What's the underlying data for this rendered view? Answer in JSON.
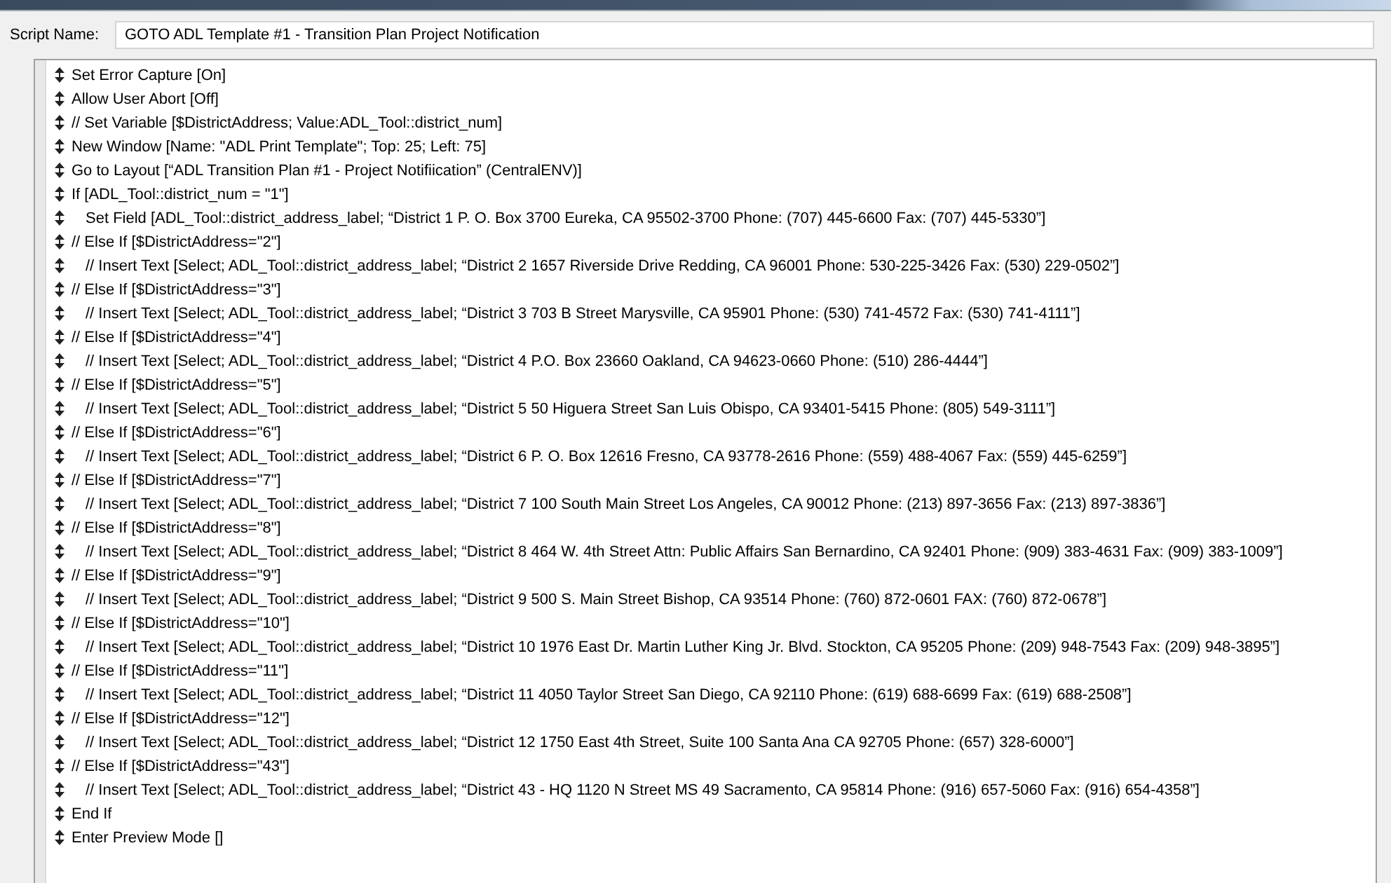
{
  "script_name": {
    "label": "Script Name:",
    "value": "GOTO ADL Template #1 - Transition Plan Project Notification"
  },
  "steps": [
    {
      "text": "Set Error Capture [On]"
    },
    {
      "text": "Allow User Abort [Off]"
    },
    {
      "text": "// Set Variable [$DistrictAddress; Value:ADL_Tool::district_num]"
    },
    {
      "text": "New Window [Name: \"ADL Print Template\"; Top: 25; Left: 75]"
    },
    {
      "text": "Go to Layout [“ADL Transition Plan #1 - Project Notifiication” (CentralENV)]"
    },
    {
      "text": "If [ADL_Tool::district_num = \"1\"]",
      "children": [
        {
          "text": "Set Field [ADL_Tool::district_address_label; “District 1 P. O. Box 3700 Eureka, CA 95502-3700 Phone: (707) 445-6600 Fax: (707) 445-5330”]"
        }
      ]
    },
    {
      "text": "// Else If [$DistrictAddress=\"2\"]",
      "children": [
        {
          "text": "// Insert Text [Select; ADL_Tool::district_address_label; “District 2 1657 Riverside Drive Redding, CA 96001 Phone: 530-225-3426 Fax: (530) 229-0502”]"
        }
      ]
    },
    {
      "text": "// Else If [$DistrictAddress=\"3\"]",
      "children": [
        {
          "text": "// Insert Text [Select; ADL_Tool::district_address_label; “District 3 703 B Street Marysville, CA 95901 Phone: (530) 741-4572 Fax: (530) 741-4111”]"
        }
      ]
    },
    {
      "text": "// Else If [$DistrictAddress=\"4\"]",
      "children": [
        {
          "text": "// Insert Text [Select; ADL_Tool::district_address_label; “District 4 P.O. Box 23660 Oakland, CA 94623-0660 Phone: (510) 286-4444”]"
        }
      ]
    },
    {
      "text": "// Else If [$DistrictAddress=\"5\"]",
      "children": [
        {
          "text": "// Insert Text [Select; ADL_Tool::district_address_label; “District 5 50 Higuera Street San Luis Obispo, CA 93401-5415 Phone: (805) 549-3111”]"
        }
      ]
    },
    {
      "text": "// Else If [$DistrictAddress=\"6\"]",
      "children": [
        {
          "text": "// Insert Text [Select; ADL_Tool::district_address_label; “District 6 P. O. Box 12616 Fresno, CA 93778-2616 Phone: (559) 488-4067 Fax: (559) 445-6259”]"
        }
      ]
    },
    {
      "text": "// Else If [$DistrictAddress=\"7\"]",
      "children": [
        {
          "text": "// Insert Text [Select; ADL_Tool::district_address_label; “District 7 100 South Main Street Los Angeles, CA 90012 Phone: (213) 897-3656 Fax: (213) 897-3836”]"
        }
      ]
    },
    {
      "text": "// Else If [$DistrictAddress=\"8\"]",
      "children": [
        {
          "text": "// Insert Text [Select; ADL_Tool::district_address_label; “District 8 464 W. 4th Street Attn: Public Affairs San Bernardino, CA 92401 Phone: (909) 383-4631 Fax: (909) 383-1009”]"
        }
      ]
    },
    {
      "text": "// Else If [$DistrictAddress=\"9\"]",
      "children": [
        {
          "text": "// Insert Text [Select; ADL_Tool::district_address_label; “District 9 500 S. Main Street Bishop, CA 93514 Phone: (760) 872-0601 FAX: (760) 872-0678”]"
        }
      ]
    },
    {
      "text": "// Else If [$DistrictAddress=\"10\"]",
      "children": [
        {
          "text": "// Insert Text [Select; ADL_Tool::district_address_label; “District 10 1976 East Dr. Martin Luther King Jr. Blvd. Stockton, CA 95205 Phone: (209) 948-7543 Fax: (209) 948-3895”]"
        }
      ]
    },
    {
      "text": "// Else If [$DistrictAddress=\"11\"]",
      "children": [
        {
          "text": "// Insert Text [Select; ADL_Tool::district_address_label; “District 11 4050 Taylor Street San Diego, CA 92110 Phone: (619) 688-6699 Fax: (619) 688-2508”]"
        }
      ]
    },
    {
      "text": "// Else If [$DistrictAddress=\"12\"]",
      "children": [
        {
          "text": "// Insert Text [Select; ADL_Tool::district_address_label; “District 12 1750 East 4th Street, Suite 100 Santa Ana CA 92705 Phone: (657) 328-6000”]"
        }
      ]
    },
    {
      "text": "// Else If [$DistrictAddress=\"43\"]",
      "children": [
        {
          "text": "// Insert Text [Select; ADL_Tool::district_address_label; “District 43 - HQ 1120 N Street MS 49 Sacramento, CA 95814 Phone: (916) 657-5060 Fax: (916) 654-4358”]"
        }
      ]
    },
    {
      "text": "End If"
    },
    {
      "text": "Enter Preview Mode []"
    }
  ]
}
